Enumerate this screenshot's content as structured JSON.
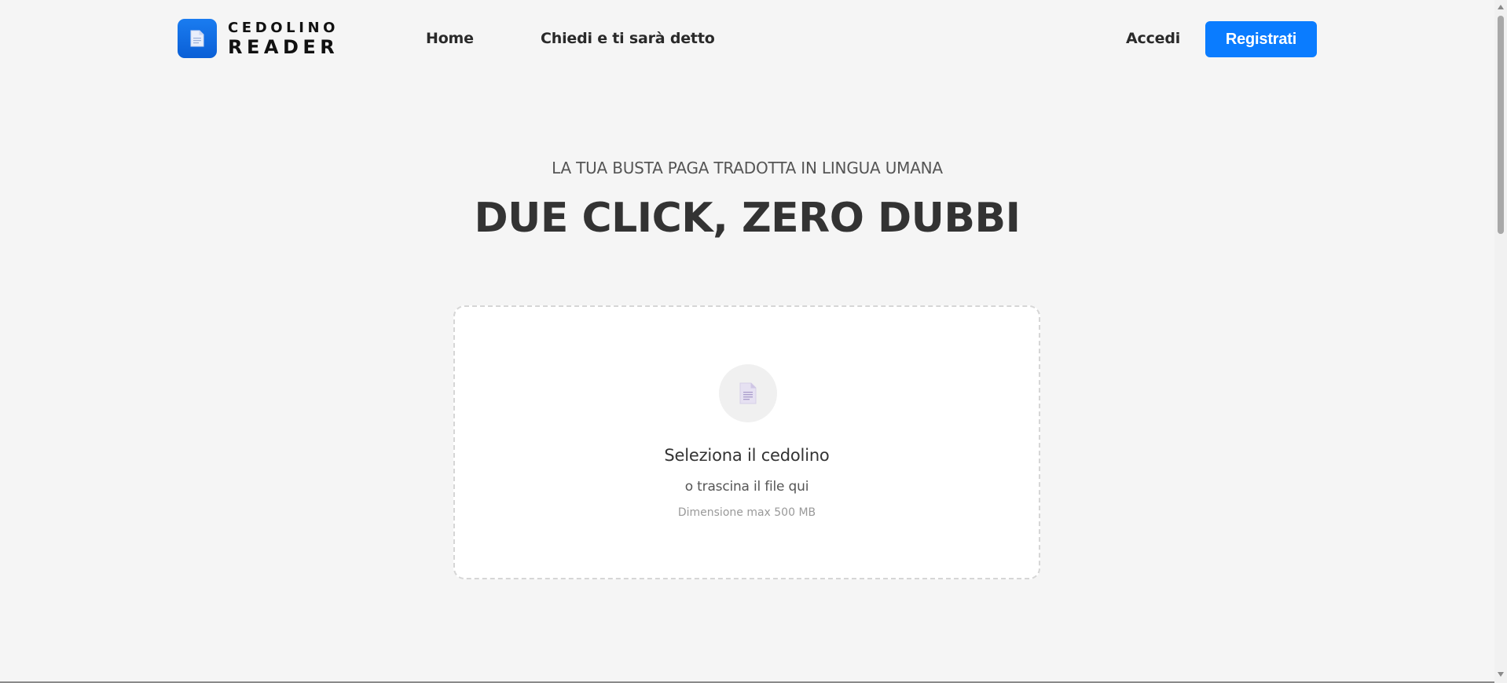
{
  "brand": {
    "name_top": "CEDOLINO",
    "name_bottom": "READER",
    "icon": "document-icon",
    "color": "#0a6ee8"
  },
  "nav": {
    "links": [
      {
        "label": "Home"
      },
      {
        "label": "Chiedi e ti sarà detto"
      }
    ],
    "login_label": "Accedi",
    "register_label": "Registrati"
  },
  "hero": {
    "subtitle": "LA TUA BUSTA PAGA TRADOTTA IN LINGUA UMANA",
    "title": "DUE CLICK, ZERO DUBBI"
  },
  "upload": {
    "icon": "file-icon",
    "title": "Seleziona il cedolino",
    "subtitle": "o trascina il file qui",
    "limit": "Dimensione max 500 MB"
  },
  "colors": {
    "accent": "#0a7cff",
    "background": "#f5f5f5",
    "card": "#ffffff"
  }
}
